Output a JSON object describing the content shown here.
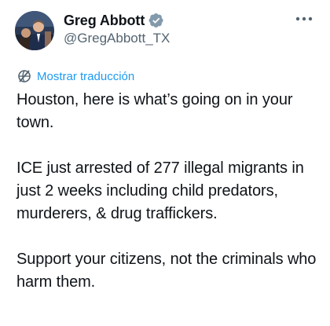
{
  "author": {
    "display_name": "Greg Abbott",
    "handle": "@GregAbbott_TX",
    "verified": true,
    "verified_color": "#1d9bf0",
    "avatar_icon": "profile-photo"
  },
  "actions": {
    "more_icon": "more-dots-icon",
    "more_label": "•••"
  },
  "translate": {
    "label": "Mostrar traducción",
    "icon": "globe-slash-icon",
    "color": "#1d9bf0"
  },
  "tweet": {
    "paragraphs": [
      "Houston, here is what’s going on in your town.",
      "ICE just arrested of 277 illegal migrants in just 2 weeks including child predators, murderers, & drug traffickers.",
      "Support your citizens, not the criminals who harm them."
    ]
  }
}
